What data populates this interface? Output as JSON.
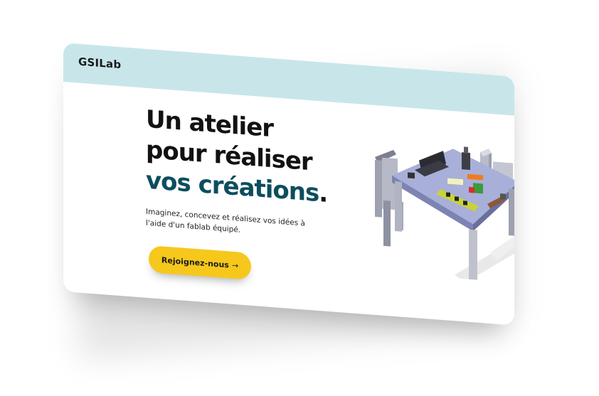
{
  "header": {
    "brand": "GSILab"
  },
  "hero": {
    "title_line1": "Un atelier",
    "title_line2": "pour réaliser",
    "title_accent": "vos créations",
    "title_period": ".",
    "description": "Imaginez, concevez et réalisez vos idées à l'aide d'un fablab équipé.",
    "cta_label": "Rejoignez-nous",
    "cta_arrow": "→"
  },
  "colors": {
    "header_bg": "#c8e6ea",
    "accent_text": "#0c4e5e",
    "cta_bg": "#f6c81c"
  }
}
